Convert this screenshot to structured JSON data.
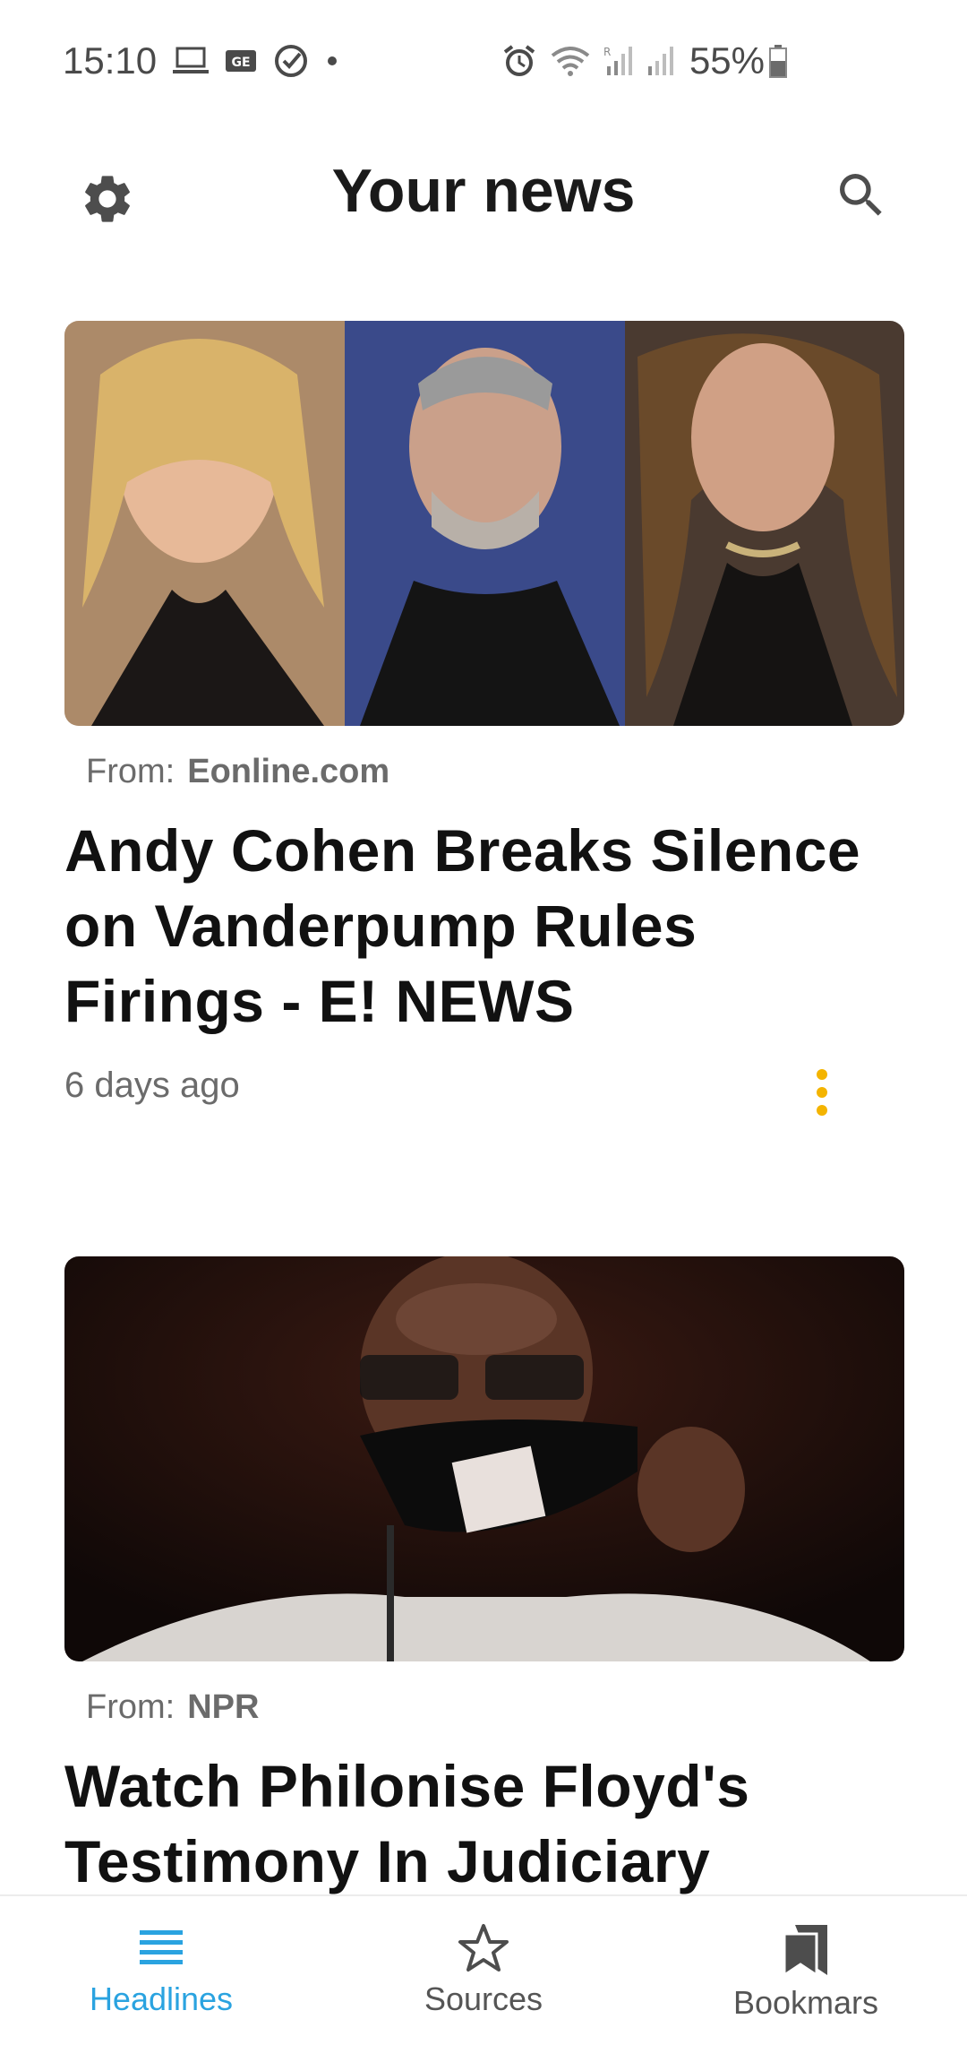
{
  "status_bar": {
    "time": "15:10",
    "battery": "55%",
    "left_icons": [
      "laptop-icon",
      "ge-icon",
      "check-circle-icon",
      "dot-icon"
    ],
    "right_icons": [
      "alarm-icon",
      "wifi-icon",
      "signal-r-icon",
      "signal-icon",
      "battery-icon"
    ]
  },
  "header": {
    "title": "Your news"
  },
  "cards": [
    {
      "from_label": "From:",
      "source": "Eonline.com",
      "headline": "Andy Cohen Breaks Silence on Vanderpump Rules Firings - E! NEWS",
      "time": "6 days ago"
    },
    {
      "from_label": "From:",
      "source": "NPR",
      "headline": "Watch Philonise Floyd's Testimony In Judiciary"
    }
  ],
  "bottom_nav": {
    "items": [
      {
        "label": "Headlines",
        "icon": "list-icon",
        "active": true
      },
      {
        "label": "Sources",
        "icon": "star-icon",
        "active": false
      },
      {
        "label": "Bookmars",
        "icon": "bookmarks-icon",
        "active": false
      }
    ]
  },
  "colors": {
    "accent": "#2aa3e0",
    "more_dots": "#f4b400",
    "text_muted": "#6b6b6b"
  }
}
